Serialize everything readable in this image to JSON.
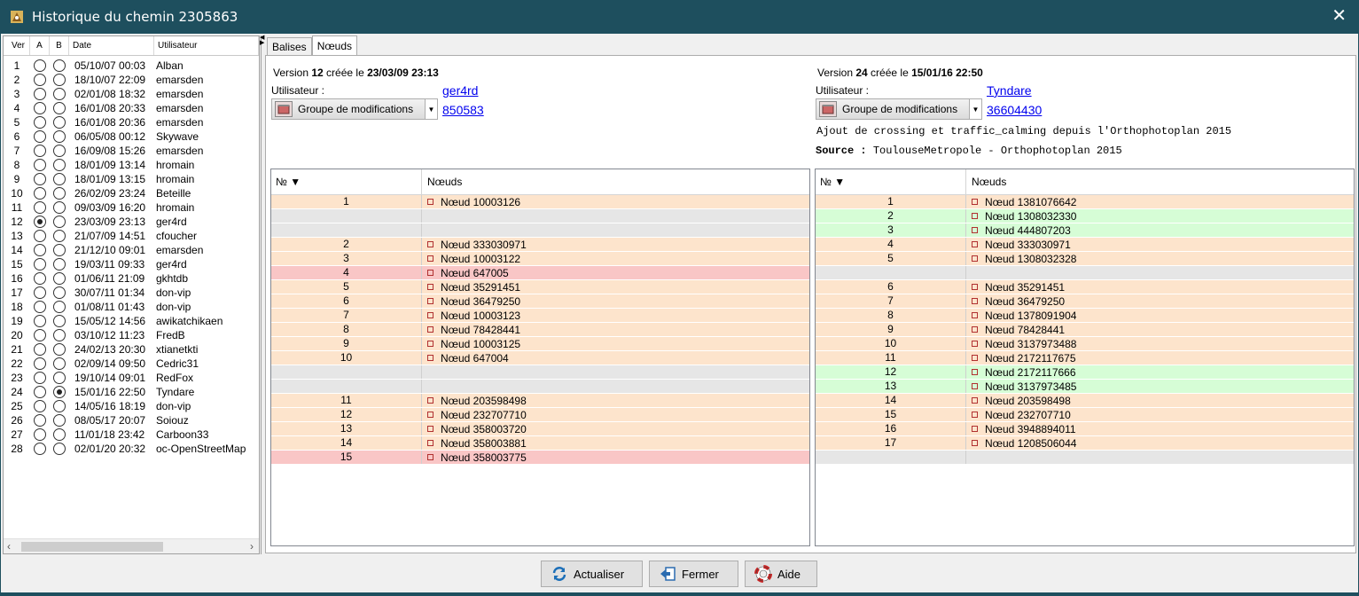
{
  "window": {
    "title": "Historique du chemin 2305863"
  },
  "versions_table": {
    "headers": {
      "ver": "Ver",
      "a": "A",
      "b": "B",
      "date": "Date",
      "user": "Utilisateur"
    },
    "rows": [
      {
        "ver": "1",
        "date": "05/10/07 00:03",
        "user": "Alban",
        "a": false,
        "b": false
      },
      {
        "ver": "2",
        "date": "18/10/07 22:09",
        "user": "emarsden",
        "a": false,
        "b": false
      },
      {
        "ver": "3",
        "date": "02/01/08 18:32",
        "user": "emarsden",
        "a": false,
        "b": false
      },
      {
        "ver": "4",
        "date": "16/01/08 20:33",
        "user": "emarsden",
        "a": false,
        "b": false
      },
      {
        "ver": "5",
        "date": "16/01/08 20:36",
        "user": "emarsden",
        "a": false,
        "b": false
      },
      {
        "ver": "6",
        "date": "06/05/08 00:12",
        "user": "Skywave",
        "a": false,
        "b": false
      },
      {
        "ver": "7",
        "date": "16/09/08 15:26",
        "user": "emarsden",
        "a": false,
        "b": false
      },
      {
        "ver": "8",
        "date": "18/01/09 13:14",
        "user": "hromain",
        "a": false,
        "b": false
      },
      {
        "ver": "9",
        "date": "18/01/09 13:15",
        "user": "hromain",
        "a": false,
        "b": false
      },
      {
        "ver": "10",
        "date": "26/02/09 23:24",
        "user": "Beteille",
        "a": false,
        "b": false
      },
      {
        "ver": "11",
        "date": "09/03/09 16:20",
        "user": "hromain",
        "a": false,
        "b": false
      },
      {
        "ver": "12",
        "date": "23/03/09 23:13",
        "user": "ger4rd",
        "a": true,
        "b": false
      },
      {
        "ver": "13",
        "date": "21/07/09 14:51",
        "user": "cfoucher",
        "a": false,
        "b": false
      },
      {
        "ver": "14",
        "date": "21/12/10 09:01",
        "user": "emarsden",
        "a": false,
        "b": false
      },
      {
        "ver": "15",
        "date": "19/03/11 09:33",
        "user": "ger4rd",
        "a": false,
        "b": false
      },
      {
        "ver": "16",
        "date": "01/06/11 21:09",
        "user": "gkhtdb",
        "a": false,
        "b": false
      },
      {
        "ver": "17",
        "date": "30/07/11 01:34",
        "user": "don-vip",
        "a": false,
        "b": false
      },
      {
        "ver": "18",
        "date": "01/08/11 01:43",
        "user": "don-vip",
        "a": false,
        "b": false
      },
      {
        "ver": "19",
        "date": "15/05/12 14:56",
        "user": "awikatchikaen",
        "a": false,
        "b": false
      },
      {
        "ver": "20",
        "date": "03/10/12 11:23",
        "user": "FredB",
        "a": false,
        "b": false
      },
      {
        "ver": "21",
        "date": "24/02/13 20:30",
        "user": "xtianetkti",
        "a": false,
        "b": false
      },
      {
        "ver": "22",
        "date": "02/09/14 09:50",
        "user": "Cedric31",
        "a": false,
        "b": false
      },
      {
        "ver": "23",
        "date": "19/10/14 09:01",
        "user": "RedFox",
        "a": false,
        "b": false
      },
      {
        "ver": "24",
        "date": "15/01/16 22:50",
        "user": "Tyndare",
        "a": false,
        "b": true
      },
      {
        "ver": "25",
        "date": "14/05/16 18:19",
        "user": "don-vip",
        "a": false,
        "b": false
      },
      {
        "ver": "26",
        "date": "08/05/17 20:07",
        "user": "Soiouz",
        "a": false,
        "b": false
      },
      {
        "ver": "27",
        "date": "11/01/18 23:42",
        "user": "Carboon33",
        "a": false,
        "b": false
      },
      {
        "ver": "28",
        "date": "02/01/20 20:32",
        "user": "oc-OpenStreetMap",
        "a": false,
        "b": false
      }
    ]
  },
  "tabs": [
    "Balises",
    "Nœuds"
  ],
  "left": {
    "version_prefix": "Version ",
    "version_num": "12",
    "created": " créée le ",
    "date": "23/03/09 23:13",
    "user_label": "Utilisateur :",
    "user": "ger4rd",
    "changeset_label": "Groupe de modifications",
    "changeset": "850583",
    "col_num": "№ ▼",
    "col_nodes": "Nœuds",
    "rows": [
      {
        "n": "1",
        "v": "Nœud 10003126",
        "s": "same"
      },
      {
        "n": "",
        "v": "",
        "s": "empty"
      },
      {
        "n": "",
        "v": "",
        "s": "empty"
      },
      {
        "n": "2",
        "v": "Nœud 333030971",
        "s": "same"
      },
      {
        "n": "3",
        "v": "Nœud 10003122",
        "s": "same"
      },
      {
        "n": "4",
        "v": "Nœud 647005",
        "s": "rem"
      },
      {
        "n": "5",
        "v": "Nœud 35291451",
        "s": "same"
      },
      {
        "n": "6",
        "v": "Nœud 36479250",
        "s": "same"
      },
      {
        "n": "7",
        "v": "Nœud 10003123",
        "s": "same"
      },
      {
        "n": "8",
        "v": "Nœud 78428441",
        "s": "same"
      },
      {
        "n": "9",
        "v": "Nœud 10003125",
        "s": "same"
      },
      {
        "n": "10",
        "v": "Nœud 647004",
        "s": "same"
      },
      {
        "n": "",
        "v": "",
        "s": "empty"
      },
      {
        "n": "",
        "v": "",
        "s": "empty"
      },
      {
        "n": "11",
        "v": "Nœud 203598498",
        "s": "same"
      },
      {
        "n": "12",
        "v": "Nœud 232707710",
        "s": "same"
      },
      {
        "n": "13",
        "v": "Nœud 358003720",
        "s": "same"
      },
      {
        "n": "14",
        "v": "Nœud 358003881",
        "s": "same"
      },
      {
        "n": "15",
        "v": "Nœud 358003775",
        "s": "rem"
      }
    ]
  },
  "right": {
    "version_prefix": "Version ",
    "version_num": "24",
    "created": " créée le ",
    "date": "15/01/16 22:50",
    "user_label": "Utilisateur :",
    "user": "Tyndare",
    "changeset_label": "Groupe de modifications",
    "changeset": "36604430",
    "comment": "Ajout de crossing et traffic_calming depuis l'Orthophotoplan 2015",
    "source_label": "Source :",
    "source": "ToulouseMetropole - Orthophotoplan 2015",
    "col_num": "№ ▼",
    "col_nodes": "Nœuds",
    "rows": [
      {
        "n": "1",
        "v": "Nœud 1381076642",
        "s": "same"
      },
      {
        "n": "2",
        "v": "Nœud 1308032330",
        "s": "add"
      },
      {
        "n": "3",
        "v": "Nœud 444807203",
        "s": "add"
      },
      {
        "n": "4",
        "v": "Nœud 333030971",
        "s": "same"
      },
      {
        "n": "5",
        "v": "Nœud 1308032328",
        "s": "same"
      },
      {
        "n": "",
        "v": "",
        "s": "empty"
      },
      {
        "n": "6",
        "v": "Nœud 35291451",
        "s": "same"
      },
      {
        "n": "7",
        "v": "Nœud 36479250",
        "s": "same"
      },
      {
        "n": "8",
        "v": "Nœud 1378091904",
        "s": "same"
      },
      {
        "n": "9",
        "v": "Nœud 78428441",
        "s": "same"
      },
      {
        "n": "10",
        "v": "Nœud 3137973488",
        "s": "same"
      },
      {
        "n": "11",
        "v": "Nœud 2172117675",
        "s": "same"
      },
      {
        "n": "12",
        "v": "Nœud 2172117666",
        "s": "add"
      },
      {
        "n": "13",
        "v": "Nœud 3137973485",
        "s": "add"
      },
      {
        "n": "14",
        "v": "Nœud 203598498",
        "s": "same"
      },
      {
        "n": "15",
        "v": "Nœud 232707710",
        "s": "same"
      },
      {
        "n": "16",
        "v": "Nœud 3948894011",
        "s": "same"
      },
      {
        "n": "17",
        "v": "Nœud 1208506044",
        "s": "same"
      },
      {
        "n": "",
        "v": "",
        "s": "empty"
      }
    ]
  },
  "buttons": {
    "refresh": "Actualiser",
    "close": "Fermer",
    "help": "Aide"
  },
  "colors": {
    "titlebar": "#1e4f5e",
    "same": "#fde4cc",
    "removed": "#f9c6c6",
    "added": "#d6fdd6",
    "empty": "#e6e6e6"
  }
}
